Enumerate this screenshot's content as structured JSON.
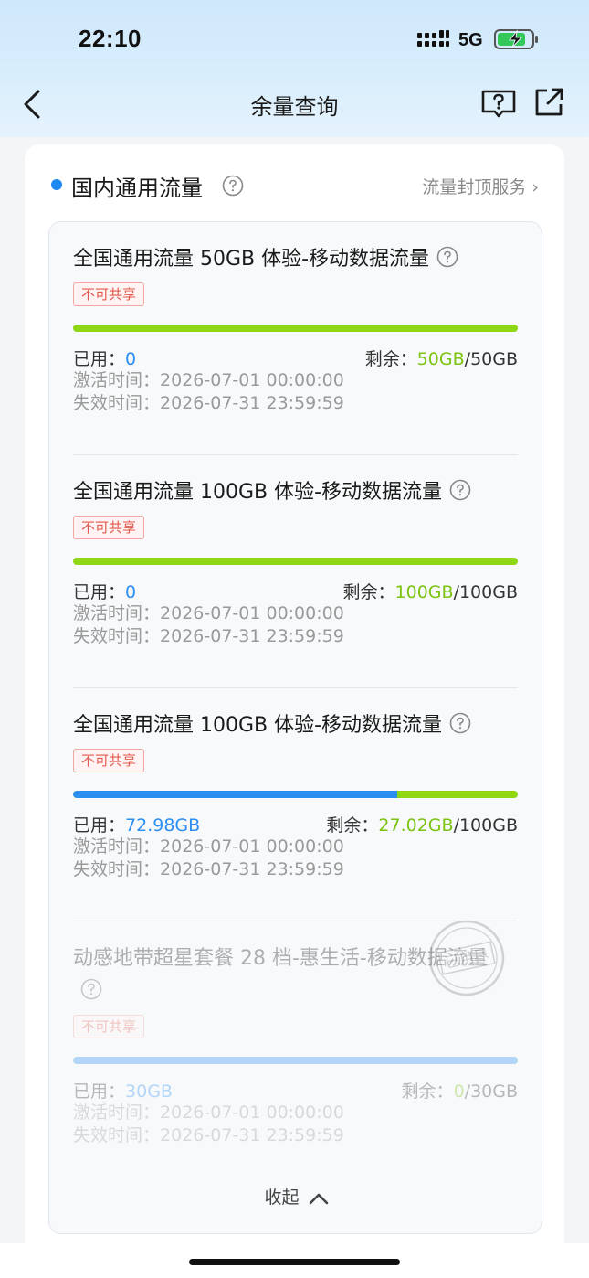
{
  "status_bar": {
    "time": "22:10",
    "network": "5G"
  },
  "nav": {
    "title": "余量查询"
  },
  "section": {
    "title": "国内通用流量",
    "cap_link": "流量封顶服务",
    "cap_chevron": "›"
  },
  "labels": {
    "used": "已用：",
    "remaining": "剩余：",
    "activation": "激活时间：",
    "expiry": "失效时间：",
    "total_sep": "/"
  },
  "packages": [
    {
      "name": "全国通用流量 50GB 体验-移动数据流量",
      "tag": "不可共享",
      "used": "0",
      "remaining": "50GB",
      "total": "50GB",
      "used_fraction": 0,
      "activation_time": "2026-07-01 00:00:00",
      "expiry_time": "2026-07-31 23:59:59"
    },
    {
      "name": "全国通用流量 100GB 体验-移动数据流量",
      "tag": "不可共享",
      "used": "0",
      "remaining": "100GB",
      "total": "100GB",
      "used_fraction": 0,
      "activation_time": "2026-07-01 00:00:00",
      "expiry_time": "2026-07-31 23:59:59"
    },
    {
      "name": "全国通用流量 100GB 体验-移动数据流量",
      "tag": "不可共享",
      "used": "72.98GB",
      "remaining": "27.02GB",
      "total": "100GB",
      "used_fraction": 0.7298,
      "activation_time": "2026-07-01 00:00:00",
      "expiry_time": "2026-07-31 23:59:59"
    },
    {
      "name": "动感地带超星套餐 28 档-惠生活-移动数据流量",
      "tag": "不可共享",
      "used": "30GB",
      "remaining": "0",
      "total": "30GB",
      "used_fraction": 1,
      "exhausted": true,
      "stamp_text": "已用尽",
      "activation_time": "2026-07-01 00:00:00",
      "expiry_time": "2026-07-31 23:59:59"
    }
  ],
  "collapse": {
    "label": "收起"
  },
  "icons": {
    "back": "chevron-left-icon",
    "help": "question-book-icon",
    "share": "share-out-icon",
    "question": "question-circle-icon",
    "collapse": "chevron-up-icon"
  },
  "colors": {
    "accent_blue": "#2b8ef0",
    "remain_green": "#7cc312",
    "bar_green": "#8fd614",
    "tag_red": "#e25a4d"
  }
}
